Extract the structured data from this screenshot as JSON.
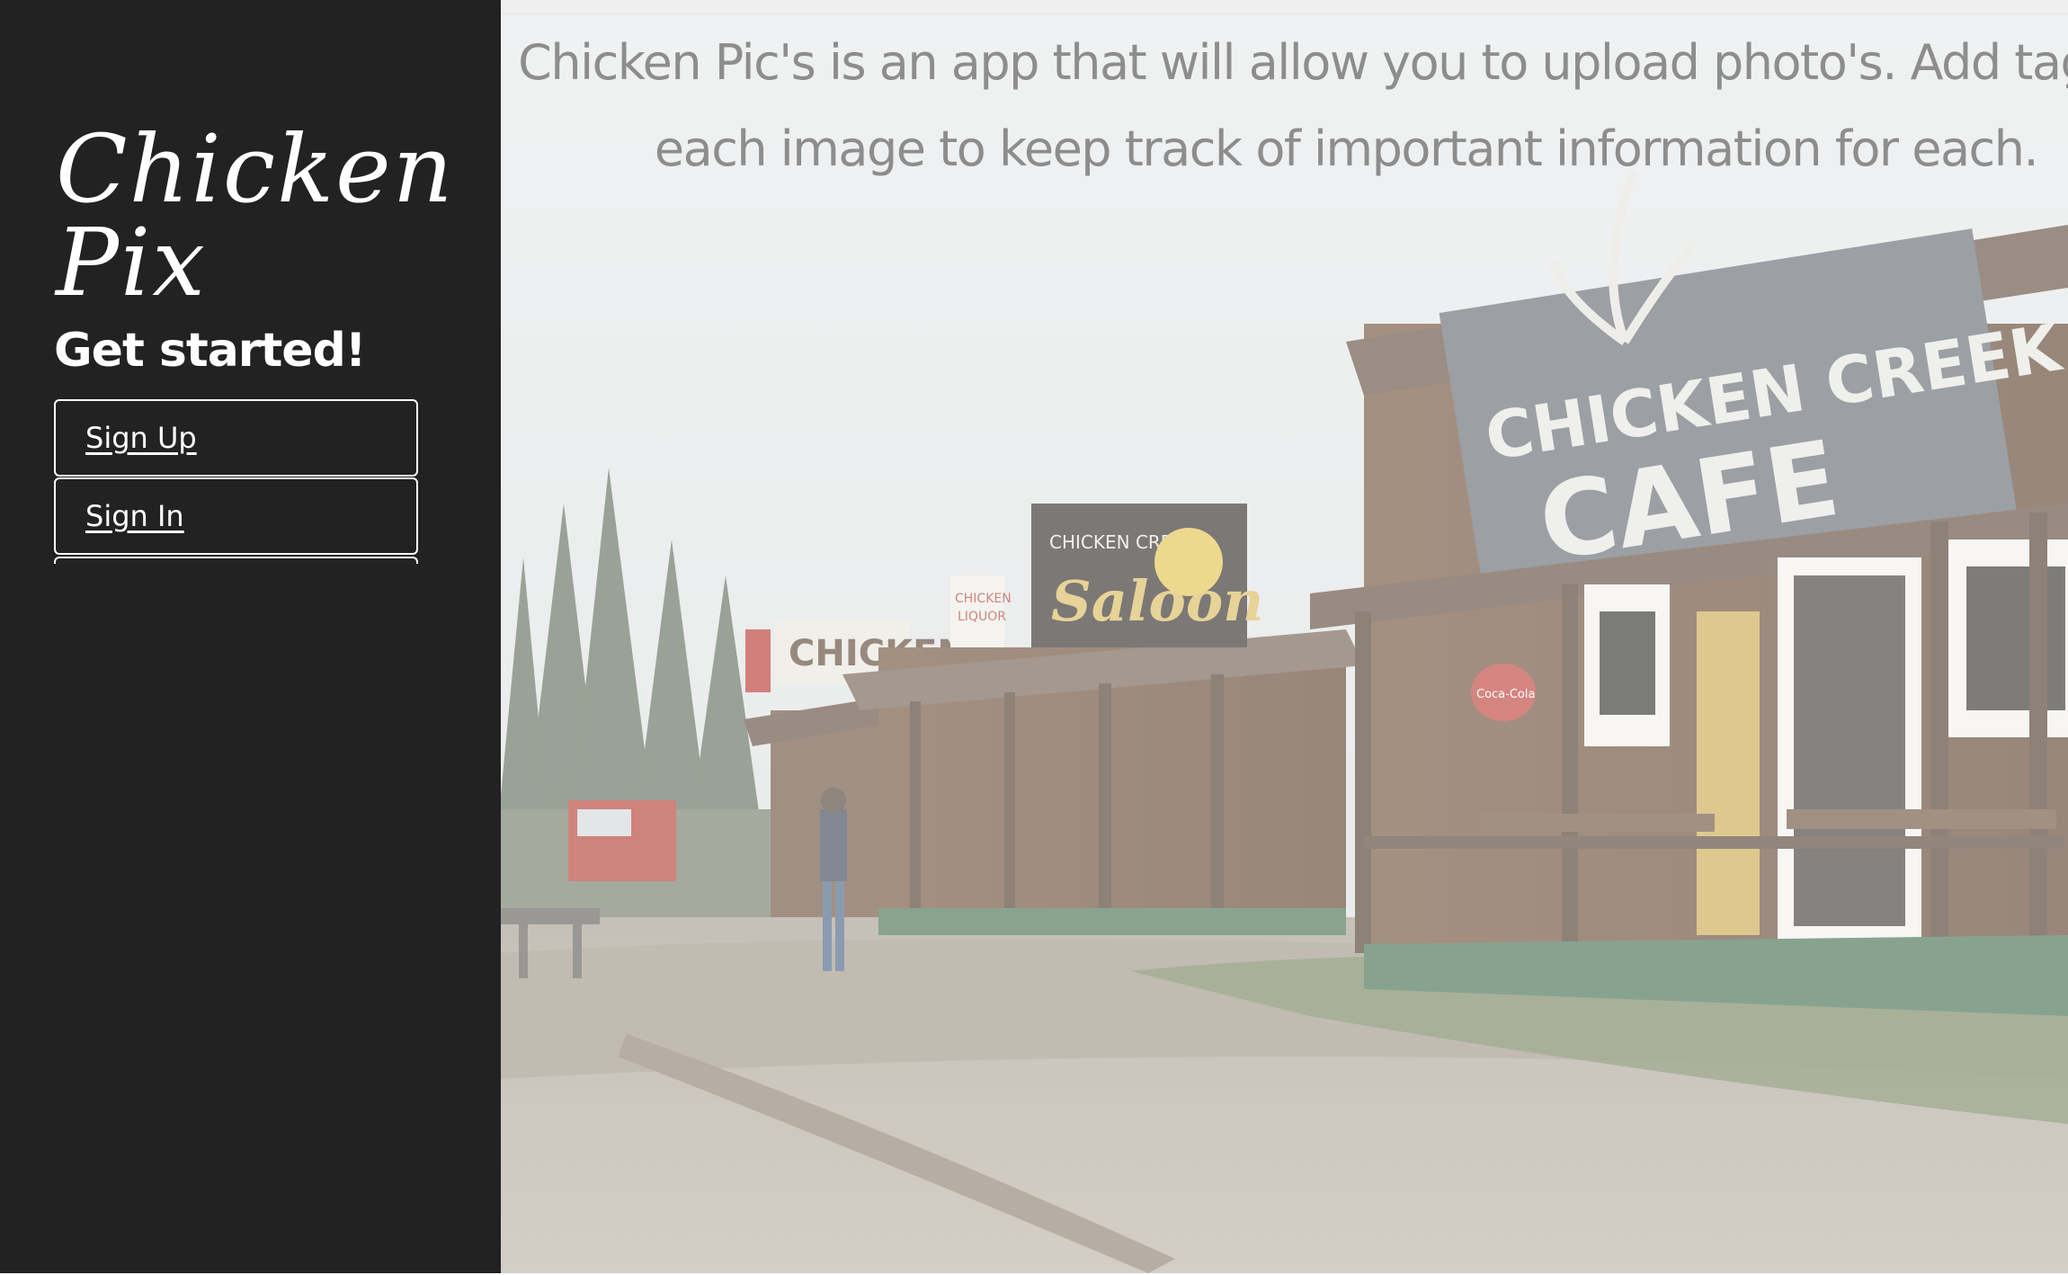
{
  "sidebar": {
    "logo_line1": "Chicken",
    "logo_line2": "Pix",
    "heading": "Get started!",
    "buttons": [
      {
        "label": "Sign Up"
      },
      {
        "label": "Sign In"
      }
    ]
  },
  "hero": {
    "tagline": "Chicken Pic's is an app that will allow you to upload photo's. Add tags to each image to keep track of important information for each.",
    "photo_signs": {
      "cafe_line1": "CHICKEN CREEK",
      "cafe_line2": "CAFE",
      "saloon_top": "CHICKEN CREEK",
      "saloon": "Saloon",
      "store": "CHICKEN",
      "liquor_line1": "CHICKEN",
      "liquor_line2": "LIQUOR",
      "cola": "Coca-Cola"
    }
  },
  "colors": {
    "sidebar_bg": "#222222",
    "sidebar_text": "#ffffff",
    "tagline_text": "#8d8d8d"
  }
}
